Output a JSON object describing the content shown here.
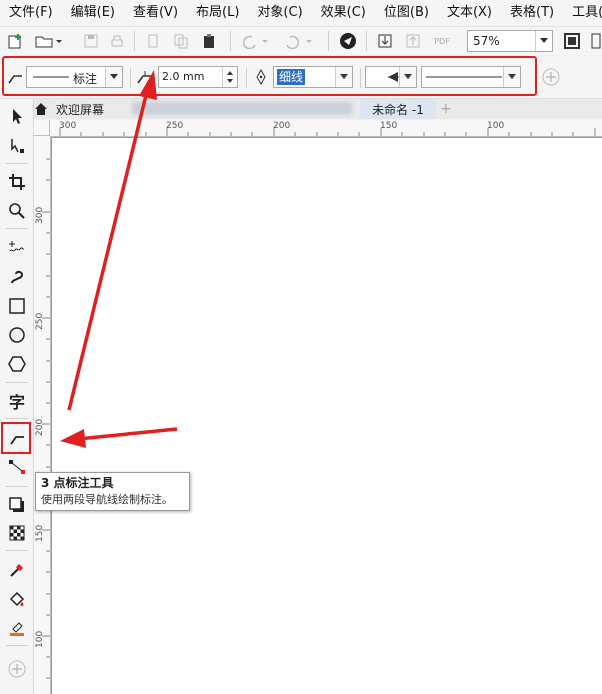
{
  "menubar": {
    "items": [
      "文件(F)",
      "编辑(E)",
      "查看(V)",
      "布局(L)",
      "对象(C)",
      "效果(C)",
      "位图(B)",
      "文本(X)",
      "表格(T)",
      "工具(O)"
    ]
  },
  "toolbar": {
    "zoom_value": "57%",
    "pdf_label": "PDF"
  },
  "propbar": {
    "callout_style_label": "标注",
    "gap_value": "2.0 mm",
    "outline_width": "细线"
  },
  "tabs": {
    "home_label": "欢迎屏幕",
    "doc_label": "未命名 -1",
    "add_label": "+"
  },
  "ruler": {
    "h_labels": [
      "300",
      "250",
      "200",
      "150",
      "100"
    ],
    "v_labels": [
      "300",
      "250",
      "200",
      "150",
      "100"
    ]
  },
  "toolbox": {
    "text_tool_glyph": "字"
  },
  "tooltip": {
    "title": "3 点标注工具",
    "description": "使用两段导航线绘制标注。"
  },
  "colors": {
    "highlight": "#e02020",
    "selection": "#2a6ecb"
  }
}
